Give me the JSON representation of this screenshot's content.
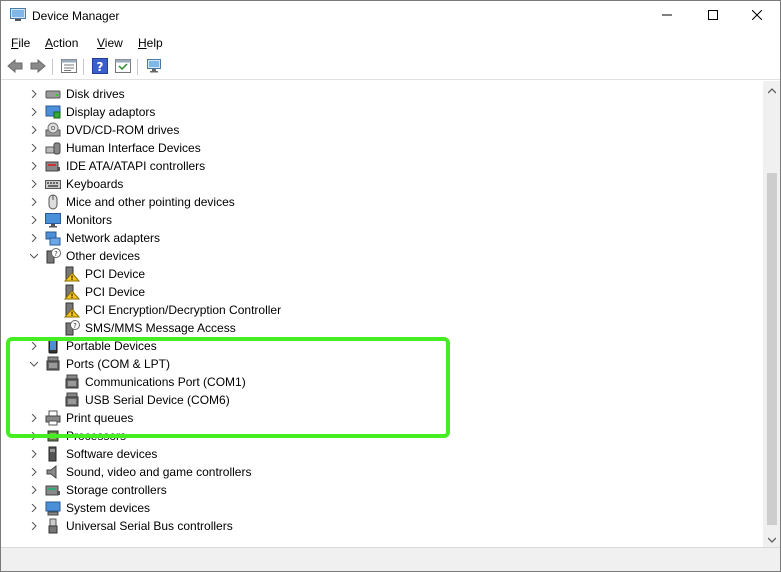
{
  "window": {
    "title": "Device Manager",
    "controls": {
      "minimize": "minimize-icon",
      "maximize": "maximize-icon",
      "close": "close-icon"
    }
  },
  "menu": [
    {
      "accel": "F",
      "rest": "ile"
    },
    {
      "accel": "A",
      "rest": "ction"
    },
    {
      "accel": "V",
      "rest": "iew"
    },
    {
      "accel": "H",
      "rest": "elp"
    }
  ],
  "toolbar": [
    "back-icon",
    "forward-icon",
    "properties-icon",
    "help-icon",
    "show-hidden-icon",
    "monitor-icon"
  ],
  "tree": {
    "disk_drives": "Disk drives",
    "display_adaptors": "Display adaptors",
    "dvd_drives": "DVD/CD-ROM drives",
    "hid": "Human Interface Devices",
    "ide": "IDE ATA/ATAPI controllers",
    "keyboards": "Keyboards",
    "mice": "Mice and other pointing devices",
    "monitors": "Monitors",
    "network": "Network adapters",
    "other_devices": "Other devices",
    "pci1": "PCI Device",
    "pci2": "PCI Device",
    "pci_crypto": "PCI Encryption/Decryption Controller",
    "sms": "SMS/MMS Message Access",
    "portable": "Portable Devices",
    "ports": "Ports (COM & LPT)",
    "com1": "Communications Port (COM1)",
    "com6": "USB Serial Device (COM6)",
    "print_queues": "Print queues",
    "processors": "Processors",
    "software": "Software devices",
    "sound": "Sound, video and game controllers",
    "storage": "Storage controllers",
    "system": "System devices",
    "usb": "Universal Serial Bus controllers"
  },
  "colors": {
    "highlight": "#44ee22",
    "warning": "#f5c518"
  }
}
